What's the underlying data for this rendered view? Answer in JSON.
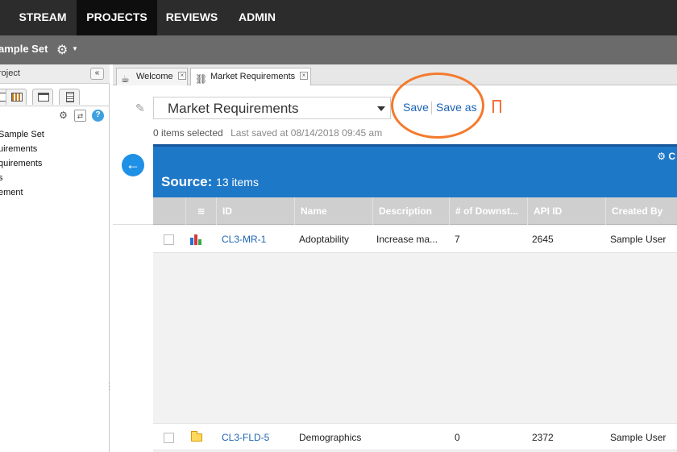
{
  "top_nav": {
    "items": [
      {
        "label": "STREAM",
        "active": false
      },
      {
        "label": "PROJECTS",
        "active": true
      },
      {
        "label": "REVIEWS",
        "active": false
      },
      {
        "label": "ADMIN",
        "active": false
      }
    ]
  },
  "project_bar": {
    "title": "ample Set",
    "settings_icon": "gear-icon"
  },
  "left_panel": {
    "title": "roject",
    "collapse_label": "«",
    "tabs": [
      "calendar-icon",
      "window-icon",
      "clipboard-icon"
    ],
    "tools": [
      "settings-icon",
      "sync-icon",
      "help-icon"
    ],
    "help_label": "?",
    "tree_items": [
      "Sample Set",
      "uirements",
      "quirements",
      "s",
      "ement"
    ]
  },
  "tabs": [
    {
      "label": "Welcome",
      "icon": "coffee-cup-icon",
      "active": false
    },
    {
      "label": "Market Requirements",
      "icon": "link-icon",
      "active": true
    }
  ],
  "toolbar": {
    "view_name": "Market Requirements",
    "save_label": "Save",
    "save_as_label": "Save as"
  },
  "status": {
    "selected": "0 items selected",
    "last_saved": "Last saved at 08/14/2018 09:45 am"
  },
  "source_band": {
    "label": "Source:",
    "count": "13 items",
    "tool_label": "C"
  },
  "grid": {
    "columns": [
      "ID",
      "Name",
      "Description",
      "# of Downst...",
      "API ID",
      "Created By"
    ],
    "rows": [
      {
        "icon": "bar-chart-icon",
        "id": "CL3-MR-1",
        "name": "Adoptability",
        "description": "Increase ma...",
        "downstream": "7",
        "api_id": "2645",
        "created_by": "Sample User"
      },
      {
        "icon": "folder-icon",
        "id": "CL3-FLD-5",
        "name": "Demographics",
        "description": "",
        "downstream": "0",
        "api_id": "2372",
        "created_by": "Sample User"
      }
    ]
  },
  "colors": {
    "accent_blue": "#1e78c8",
    "highlight_orange": "#f47a2d",
    "nav_bg": "#2c2c2c"
  }
}
